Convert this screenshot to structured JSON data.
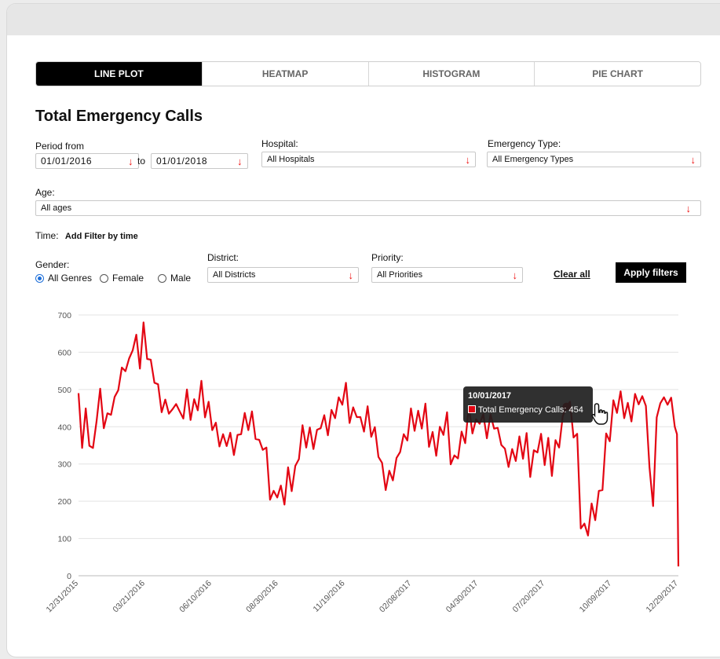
{
  "tabs": [
    "LINE PLOT",
    "HEATMAP",
    "HISTOGRAM",
    "PIE CHART"
  ],
  "title": "Total Emergency Calls",
  "filters": {
    "period_label": "Period from",
    "from_date": "01/01/2016",
    "to_label": "to",
    "to_date": "01/01/2018",
    "hospital_label": "Hospital:",
    "hospital_value": "All Hospitals",
    "emergency_label": "Emergency Type:",
    "emergency_value": "All Emergency Types",
    "age_label": "Age:",
    "age_value": "All ages",
    "time_label": "Time:",
    "time_action": "Add Filter by time",
    "gender_label": "Gender:",
    "gender_options": [
      "All Genres",
      "Female",
      "Male"
    ],
    "district_label": "District:",
    "district_value": "All Districts",
    "priority_label": "Priority:",
    "priority_value": "All Priorities",
    "clear_all": "Clear all",
    "apply": "Apply filters"
  },
  "icons": {
    "dropdown": "arrow-down-icon",
    "cursor": "hand-pointer-icon"
  },
  "colors": {
    "line": "#e30613",
    "active_tab": "#000000"
  },
  "tooltip": {
    "date": "10/01/2017",
    "text": "Total Emergency Calls: 454"
  },
  "chart_data": {
    "type": "line",
    "title": "",
    "xlabel": "",
    "ylabel": "",
    "ylim": [
      0,
      700
    ],
    "yticks": [
      0,
      100,
      200,
      300,
      400,
      500,
      600,
      700
    ],
    "xtick_labels": [
      "12/31/2015",
      "03/21/2016",
      "06/10/2016",
      "08/30/2016",
      "11/19/2016",
      "02/08/2017",
      "04/30/2017",
      "07/20/2017",
      "10/09/2017",
      "12/29/2017"
    ],
    "grid": true,
    "legend": "none",
    "series": [
      {
        "values": [
          [
            0,
            490
          ],
          [
            5,
            380
          ],
          [
            10,
            420
          ],
          [
            15,
            370
          ],
          [
            20,
            330
          ],
          [
            25,
            420
          ],
          [
            30,
            460
          ],
          [
            35,
            430
          ],
          [
            40,
            410
          ],
          [
            45,
            450
          ],
          [
            50,
            470
          ],
          [
            55,
            500
          ],
          [
            60,
            520
          ],
          [
            65,
            580
          ],
          [
            70,
            560
          ],
          [
            75,
            620
          ],
          [
            80,
            640
          ],
          [
            85,
            600
          ],
          [
            90,
            650
          ],
          [
            95,
            610
          ],
          [
            100,
            560
          ],
          [
            105,
            530
          ],
          [
            110,
            510
          ],
          [
            115,
            480
          ],
          [
            120,
            440
          ],
          [
            125,
            460
          ],
          [
            130,
            430
          ],
          [
            135,
            470
          ],
          [
            140,
            440
          ],
          [
            145,
            460
          ],
          [
            150,
            470
          ],
          [
            155,
            440
          ],
          [
            160,
            460
          ],
          [
            165,
            450
          ],
          [
            170,
            480
          ],
          [
            175,
            460
          ],
          [
            180,
            440
          ],
          [
            185,
            410
          ],
          [
            190,
            400
          ],
          [
            195,
            350
          ],
          [
            200,
            340
          ],
          [
            205,
            380
          ],
          [
            210,
            360
          ],
          [
            215,
            340
          ],
          [
            220,
            370
          ],
          [
            225,
            380
          ],
          [
            230,
            400
          ],
          [
            235,
            420
          ],
          [
            240,
            420
          ],
          [
            245,
            380
          ],
          [
            250,
            360
          ],
          [
            255,
            380
          ],
          [
            260,
            310
          ],
          [
            265,
            230
          ],
          [
            270,
            210
          ],
          [
            275,
            220
          ],
          [
            280,
            240
          ],
          [
            285,
            230
          ],
          [
            290,
            260
          ],
          [
            295,
            250
          ],
          [
            300,
            280
          ],
          [
            305,
            320
          ],
          [
            310,
            360
          ],
          [
            315,
            380
          ],
          [
            320,
            370
          ],
          [
            325,
            360
          ],
          [
            330,
            380
          ],
          [
            335,
            400
          ],
          [
            340,
            390
          ],
          [
            345,
            410
          ],
          [
            350,
            420
          ],
          [
            355,
            440
          ],
          [
            360,
            470
          ],
          [
            365,
            460
          ],
          [
            370,
            480
          ],
          [
            375,
            440
          ],
          [
            380,
            430
          ],
          [
            385,
            440
          ],
          [
            390,
            420
          ],
          [
            395,
            430
          ],
          [
            400,
            420
          ],
          [
            405,
            400
          ],
          [
            410,
            380
          ],
          [
            415,
            330
          ],
          [
            420,
            300
          ],
          [
            425,
            270
          ],
          [
            430,
            250
          ],
          [
            435,
            280
          ],
          [
            440,
            300
          ],
          [
            445,
            340
          ],
          [
            450,
            380
          ],
          [
            455,
            400
          ],
          [
            460,
            420
          ],
          [
            465,
            410
          ],
          [
            470,
            430
          ],
          [
            475,
            400
          ],
          [
            480,
            420
          ],
          [
            485,
            380
          ],
          [
            490,
            360
          ],
          [
            495,
            340
          ],
          [
            500,
            390
          ],
          [
            505,
            380
          ],
          [
            510,
            400
          ],
          [
            515,
            330
          ],
          [
            520,
            300
          ],
          [
            525,
            330
          ],
          [
            530,
            380
          ],
          [
            535,
            400
          ],
          [
            540,
            420
          ],
          [
            545,
            410
          ],
          [
            550,
            400
          ],
          [
            555,
            420
          ],
          [
            560,
            430
          ],
          [
            565,
            410
          ],
          [
            570,
            400
          ],
          [
            575,
            420
          ],
          [
            580,
            380
          ],
          [
            585,
            360
          ],
          [
            590,
            340
          ],
          [
            595,
            330
          ],
          [
            600,
            310
          ],
          [
            605,
            330
          ],
          [
            610,
            360
          ],
          [
            615,
            320
          ],
          [
            620,
            340
          ],
          [
            625,
            300
          ],
          [
            630,
            310
          ],
          [
            635,
            350
          ],
          [
            640,
            370
          ],
          [
            645,
            300
          ],
          [
            650,
            330
          ],
          [
            655,
            300
          ],
          [
            660,
            340
          ],
          [
            665,
            360
          ],
          [
            670,
            420
          ],
          [
            675,
            454
          ],
          [
            680,
            430
          ],
          [
            685,
            400
          ],
          [
            690,
            360
          ],
          [
            695,
            140
          ],
          [
            700,
            135
          ],
          [
            705,
            150
          ],
          [
            710,
            160
          ],
          [
            715,
            175
          ],
          [
            720,
            210
          ],
          [
            725,
            240
          ],
          [
            730,
            380
          ],
          [
            735,
            400
          ],
          [
            740,
            440
          ],
          [
            745,
            460
          ],
          [
            750,
            480
          ],
          [
            755,
            430
          ],
          [
            760,
            420
          ],
          [
            765,
            450
          ],
          [
            770,
            460
          ],
          [
            775,
            480
          ],
          [
            780,
            470
          ],
          [
            785,
            460
          ],
          [
            790,
            250
          ],
          [
            795,
            220
          ],
          [
            800,
            400
          ],
          [
            805,
            480
          ],
          [
            810,
            470
          ],
          [
            815,
            460
          ],
          [
            820,
            440
          ],
          [
            825,
            430
          ],
          [
            828,
            380
          ],
          [
            830,
            25
          ]
        ]
      }
    ]
  }
}
